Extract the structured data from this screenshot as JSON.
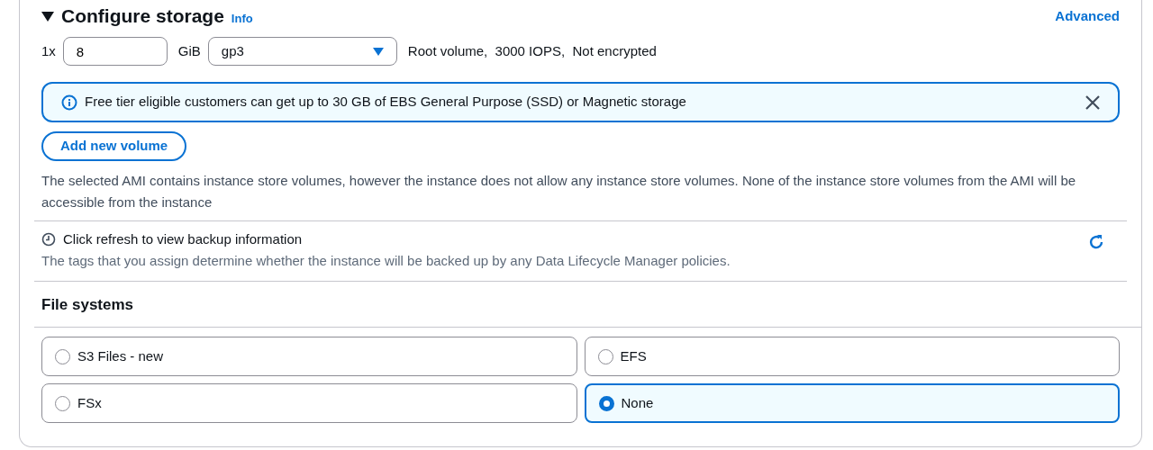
{
  "section": {
    "title": "Configure storage",
    "expanded": true,
    "info_link": "Info",
    "advanced_link": "Advanced"
  },
  "volume": {
    "count": "1x",
    "size": "8",
    "unit": "GiB",
    "type": "gp3",
    "details": "Root volume,  3000 IOPS,  Not encrypted"
  },
  "alert": {
    "text": "Free tier eligible customers can get up to 30 GB of EBS General Purpose (SSD) or Magnetic storage"
  },
  "add_button": "Add new volume",
  "notice": "The selected AMI contains instance store volumes, however the instance does not allow any instance store volumes. None of the instance store volumes from the AMI will be accessible from the instance",
  "backup": {
    "title": "Click refresh to view backup information",
    "description": "The tags that you assign determine whether the instance will be backed up by any Data Lifecycle Manager policies."
  },
  "file_systems": {
    "title": "File systems",
    "options": [
      {
        "label": "S3 Files - new",
        "selected": false
      },
      {
        "label": "EFS",
        "selected": false
      },
      {
        "label": "FSx",
        "selected": false
      },
      {
        "label": "None",
        "selected": true
      }
    ]
  }
}
